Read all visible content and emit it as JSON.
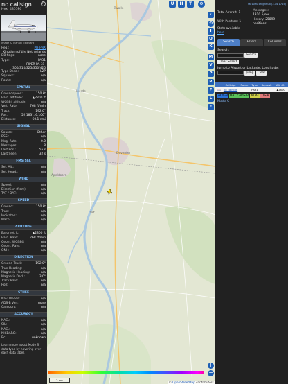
{
  "info": {
    "callsign": "no callsign",
    "hex_label": "Hex:",
    "hex": "4855F6",
    "photo_credit": "Image © Manuel Estevant",
    "fields": [
      {
        "key": "Reg.:",
        "value": "PH-PNX",
        "link": true
      },
      {
        "key": "",
        "value": "Kingdom of the Netherlands"
      },
      {
        "key": "DB flags:",
        "value": "none"
      },
      {
        "key": "Type:",
        "value": "PA31"
      },
      {
        "key": "",
        "value": "PIPER PA-31-300/310/325/350/425"
      },
      {
        "key": "Type Desc.:",
        "value": "L2P"
      },
      {
        "key": "Squawk:",
        "value": "n/a"
      },
      {
        "key": "Route:",
        "value": "n/a"
      }
    ],
    "sections": [
      {
        "title": "SPATIAL",
        "rows": [
          [
            "Groundspeed:",
            "150 kt"
          ],
          [
            "Baro. altitude:",
            "▲2800 ft"
          ],
          [
            "WGS84 altitude:",
            "n/a"
          ],
          [
            "Vert. Rate:",
            "768 ft/min"
          ],
          [
            "Track:",
            "192.0°"
          ],
          [
            "Pos.:",
            "52.183°, 6.106°"
          ],
          [
            "Distance:",
            "60.1 nmi"
          ]
        ]
      },
      {
        "title": "SIGNAL",
        "rows": [
          [
            "Source:",
            "Other"
          ],
          [
            "RSSI:",
            "n/a"
          ],
          [
            "Msg. Rate:",
            "0.0"
          ],
          [
            "Messages:",
            "8"
          ],
          [
            "",
            ""
          ],
          [
            "Last Pos.:",
            "55 s"
          ],
          [
            "Last Seen:",
            "32 s"
          ]
        ]
      },
      {
        "title": "FMS SEL",
        "rows": [
          [
            "Sel. Alt.:",
            "n/a"
          ],
          [
            "Sel. Head.:",
            "n/a"
          ]
        ]
      },
      {
        "title": "WIND",
        "rows": [
          [
            "Speed:",
            "n/a"
          ],
          [
            "Direction (from):",
            "n/a"
          ],
          [
            "TAT / OAT:",
            "n/a"
          ]
        ]
      },
      {
        "title": "SPEED",
        "rows": [
          [
            "Ground:",
            "150 kt"
          ],
          [
            "True:",
            "n/a"
          ],
          [
            "Indicated:",
            "n/a"
          ],
          [
            "Mach:",
            "n/a"
          ]
        ]
      },
      {
        "title": "ALTITUDE",
        "rows": [
          [
            "Barometric:",
            "▲2800 ft"
          ],
          [
            "Baro. Rate:",
            "768 ft/min"
          ],
          [
            "Geom. WGS84:",
            "n/a"
          ],
          [
            "Geom. Rate:",
            "n/a"
          ],
          [
            "QNH:",
            "n/a"
          ]
        ]
      },
      {
        "title": "DIRECTION",
        "rows": [
          [
            "Ground Track:",
            "192.0°"
          ],
          [
            "True Heading:",
            "n/a"
          ],
          [
            "Magnetic Heading:",
            "n/a"
          ],
          [
            "Magnetic Decl.:",
            "3.0°"
          ],
          [
            "Track Rate:",
            "n/a"
          ],
          [
            "Roll:",
            "n/a"
          ]
        ]
      },
      {
        "title": "STUFF",
        "rows": [
          [
            "Nav. Modes:",
            "n/a"
          ],
          [
            "ADS-B Ver.:",
            "none"
          ],
          [
            "Category:",
            "n/a"
          ]
        ]
      },
      {
        "title": "ACCURACY",
        "rows": [
          [
            "NACₚ:",
            "n/a"
          ],
          [
            "SIL:",
            "n/a"
          ],
          [
            "NACᵥ:",
            "n/a"
          ],
          [
            "NICBARO:",
            "n/a"
          ],
          [
            "Rc:",
            "unknown"
          ]
        ]
      }
    ],
    "footer": "Learn more about Mode S data type by hovering over each data label."
  },
  "map": {
    "top_buttons": [
      "U",
      "H",
      "T"
    ],
    "side_buttons": [
      "⟲",
      "I",
      "O",
      "K",
      "M",
      "V",
      "P",
      "R",
      "F",
      "L",
      "F"
    ],
    "zoom_in": "+",
    "zoom_out": "−",
    "scale": "2 nm",
    "attribution_prefix": "©",
    "attribution_link": "OpenStreetMap",
    "attribution_suffix": "contributors.",
    "altitude_ticks": [
      "",
      "",
      "",
      "",
      "",
      "",
      "",
      "",
      "",
      "",
      ""
    ],
    "places": [
      {
        "name": "Zwolle"
      },
      {
        "name": "Deventer"
      },
      {
        "name": "Apeldoorn"
      },
      {
        "name": "Heerde"
      },
      {
        "name": "Olst"
      }
    ]
  },
  "sidebar": {
    "github_link": "tar1090 on github (3.14.1715)",
    "stats": {
      "total_label": "Total Aircraft:",
      "total": "1",
      "messages_label": "Messages:",
      "messages": "1310.5/sec",
      "position_label": "With Position:",
      "position": "1",
      "history_label": "History:",
      "history": "25899 positions",
      "stats_label": "Stats available",
      "stats_link": "here"
    },
    "tabs": [
      "Search",
      "Filters",
      "Columns"
    ],
    "search_label": "Search:",
    "search_button": "Search",
    "clear_search": "Clear Search",
    "jump_label": "Jump to Airport or Latitude, Longitude:",
    "jump_button": "Jump",
    "clear_button": "Clear",
    "table": {
      "headers": [
        "",
        "Callsign",
        "Route",
        "Type",
        "Squawk",
        "Alt. (ft)"
      ],
      "rows": [
        {
          "flag": "",
          "callsign": "no callsign",
          "route": "",
          "type": "PA31",
          "squawk": "",
          "alt": "▲2800"
        }
      ]
    },
    "chips": [
      {
        "label": "ADS-B",
        "color": "#2a73d6"
      },
      {
        "label": "UAT / ADS-R",
        "color": "#5ac25a"
      },
      {
        "label": "MLAT",
        "color": "#d1d14a"
      },
      {
        "label": "TIS-B",
        "color": "#e07a7a"
      }
    ],
    "mode_s": "Mode-S"
  }
}
